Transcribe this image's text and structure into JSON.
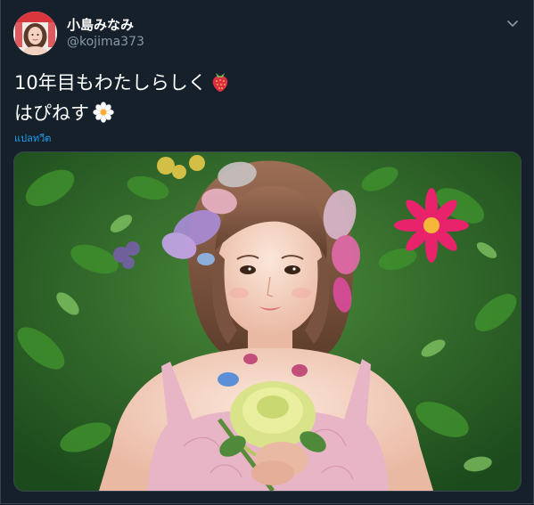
{
  "tweet": {
    "display_name": "小島みなみ",
    "handle": "@kojima373",
    "text_line1": "10年目もわたしらしく",
    "text_line1_emoji": "strawberry",
    "text_line2": "はぴねす",
    "text_line2_emoji": "white-flower",
    "translate_label": "แปลทวีต"
  },
  "icons": {
    "menu": "chevron-down-icon",
    "avatar": "profile-avatar",
    "media": "tweet-photo"
  },
  "colors": {
    "background": "#15202b",
    "link": "#1da1f2",
    "secondary_text": "#8899a6",
    "border": "#38444d"
  }
}
